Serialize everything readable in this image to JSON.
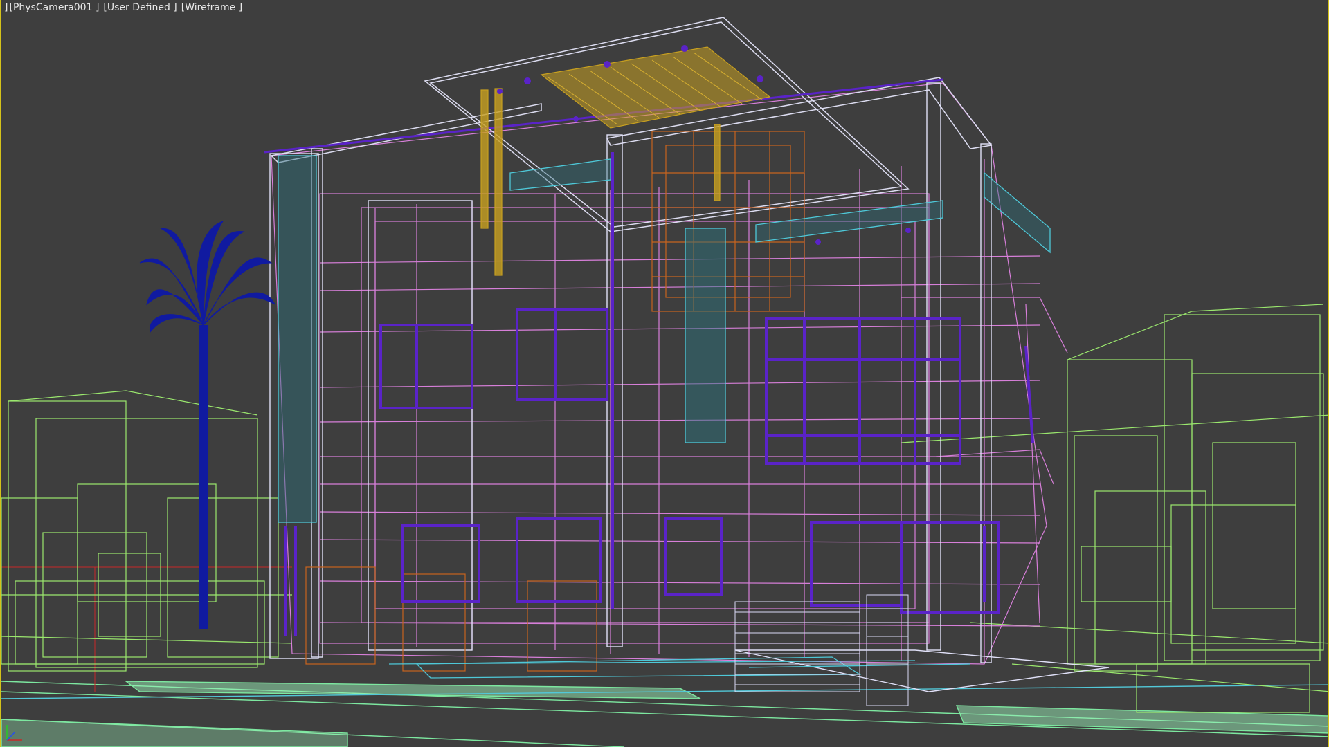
{
  "viewport": {
    "camera_label": "PhysCamera001",
    "view_label": "User Defined",
    "shading_label": "Wireframe",
    "lead_bracket": "]"
  },
  "colors": {
    "background": "#3e3e3e",
    "active_border": "#d4c21a",
    "context_buildings": "#9be86e",
    "house_frame": "#d77fd9",
    "window_frames": "#5a23c8",
    "louvers": "#4ec8d8",
    "pergola": "#c8a020",
    "interior": "#c8641e",
    "palm_tree": "#101aa0",
    "ground": "#7de8a0"
  },
  "icons": {
    "axis_tripod": "axis-tripod-icon",
    "palm": "palm-tree-icon"
  }
}
